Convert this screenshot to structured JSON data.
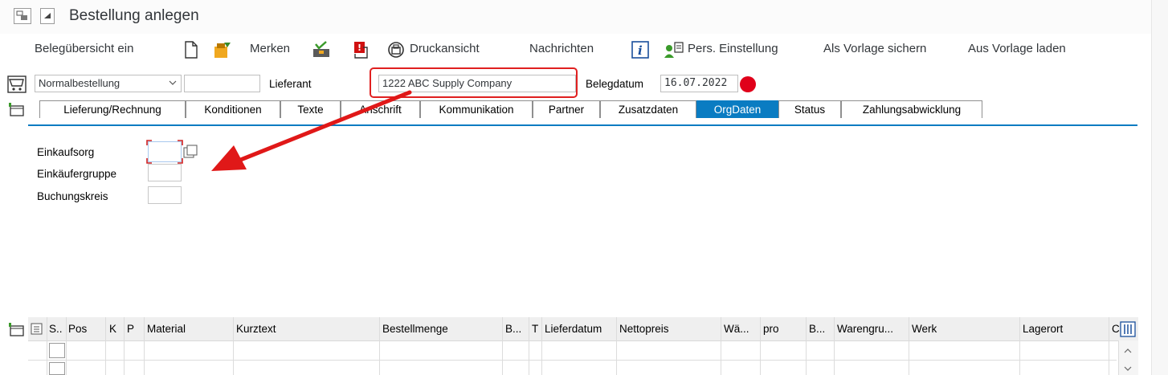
{
  "window": {
    "title": "Bestellung anlegen"
  },
  "toolbar": {
    "doc_overview": "Belegübersicht ein",
    "remember": "Merken",
    "print_preview": "Druckansicht",
    "messages": "Nachrichten",
    "personal_settings": "Pers. Einstellung",
    "save_template": "Als Vorlage sichern",
    "load_template": "Aus Vorlage laden"
  },
  "header": {
    "order_type": "Normalbestellung",
    "vendor_label": "Lieferant",
    "vendor_value": "1222 ABC Supply Company",
    "doc_date_label": "Belegdatum",
    "doc_date_value": "16.07.2022"
  },
  "tabs": [
    {
      "label": "Lieferung/Rechnung"
    },
    {
      "label": "Konditionen"
    },
    {
      "label": "Texte"
    },
    {
      "label": "Anschrift"
    },
    {
      "label": "Kommunikation"
    },
    {
      "label": "Partner"
    },
    {
      "label": "Zusatzdaten"
    },
    {
      "label": "OrgDaten"
    },
    {
      "label": "Status"
    },
    {
      "label": "Zahlungsabwicklung"
    }
  ],
  "active_tab": "OrgDaten",
  "orgdata": {
    "purch_org_label": "Einkaufsorg",
    "purch_org_value": "",
    "purch_group_label": "Einkäufergruppe",
    "purch_group_value": "",
    "company_code_label": "Buchungskreis",
    "company_code_value": ""
  },
  "items_table": {
    "columns": [
      "S..",
      "Pos",
      "K",
      "P",
      "Material",
      "Kurztext",
      "Bestellmenge",
      "B...",
      "T",
      "Lieferdatum",
      "Nettopreis",
      "Wä...",
      "pro",
      "B...",
      "Warengru...",
      "Werk",
      "Lagerort",
      "C"
    ]
  },
  "colors": {
    "accent": "#0a7cc2",
    "highlight": "#e02020",
    "status_red": "#e0001a"
  }
}
